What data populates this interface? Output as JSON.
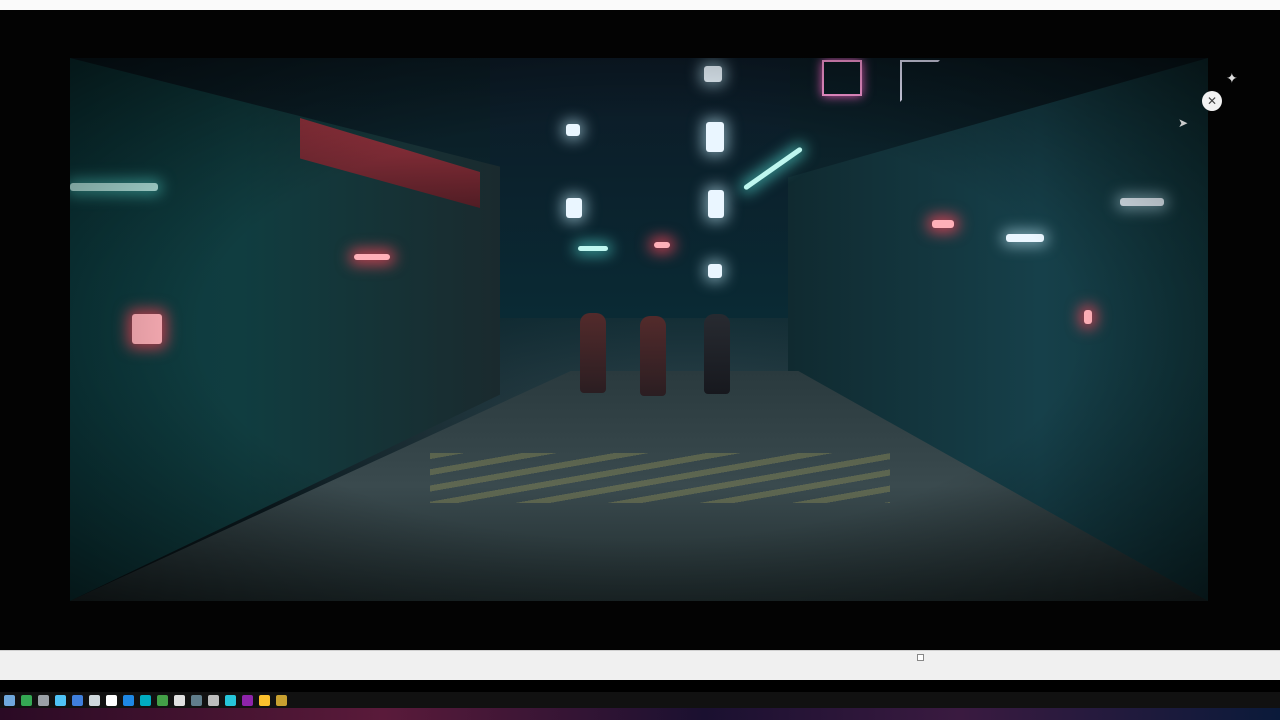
{
  "viewer": {
    "close_icon": "close-circle-icon",
    "sparkle_icon": "sparkle-icon",
    "cursor_icon": "mouse-cursor-icon"
  },
  "video": {
    "scene": "neon-alley"
  },
  "taskbar": {
    "icons": [
      {
        "name": "start-icon",
        "color": "#6fa8dc"
      },
      {
        "name": "chrome-icon",
        "color": "#34a853"
      },
      {
        "name": "app-icon",
        "color": "#9aa0a6"
      },
      {
        "name": "edge-icon",
        "color": "#4fc3f7"
      },
      {
        "name": "app-icon",
        "color": "#3f7fdc"
      },
      {
        "name": "steam-icon",
        "color": "#cfd8dc"
      },
      {
        "name": "app-icon",
        "color": "#ffffff"
      },
      {
        "name": "app-icon",
        "color": "#1e88e5"
      },
      {
        "name": "app-icon",
        "color": "#00acc1"
      },
      {
        "name": "app-icon",
        "color": "#43a047"
      },
      {
        "name": "app-icon",
        "color": "#e0e0e0"
      },
      {
        "name": "app-icon",
        "color": "#607d8b"
      },
      {
        "name": "app-icon",
        "color": "#bdbdbd"
      },
      {
        "name": "app-icon",
        "color": "#26c6da"
      },
      {
        "name": "app-icon",
        "color": "#8e24aa"
      },
      {
        "name": "app-icon",
        "color": "#fbc02d"
      },
      {
        "name": "app-icon",
        "color": "#c8a030"
      }
    ]
  }
}
